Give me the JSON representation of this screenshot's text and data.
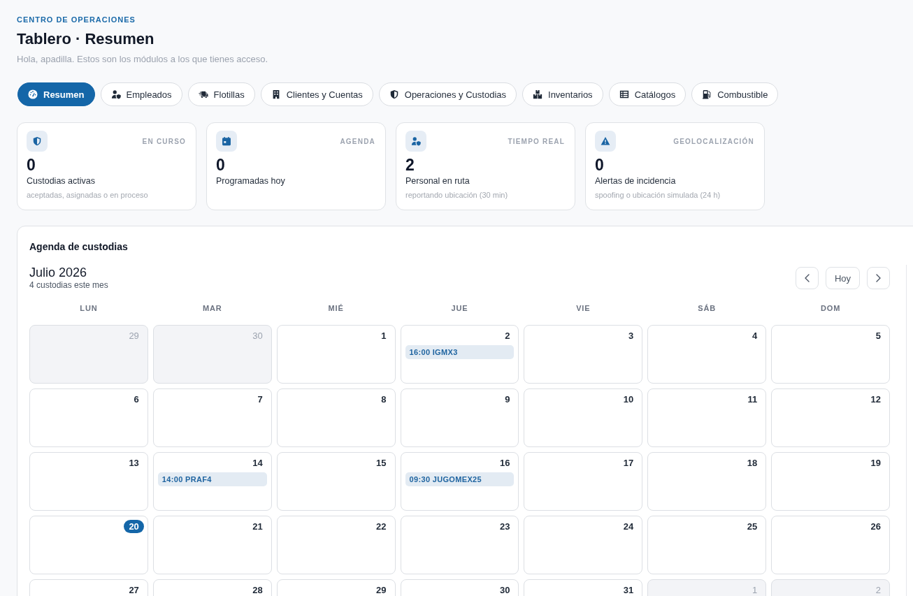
{
  "header": {
    "eyebrow": "CENTRO DE OPERACIONES",
    "title": "Tablero · Resumen",
    "subtitle": "Hola, apadilla. Estos son los módulos a los que tienes acceso."
  },
  "tabs": [
    {
      "label": "Resumen",
      "selected": true
    },
    {
      "label": "Empleados",
      "selected": false
    },
    {
      "label": "Flotillas",
      "selected": false
    },
    {
      "label": "Clientes y Cuentas",
      "selected": false
    },
    {
      "label": "Operaciones y Custodias",
      "selected": false
    },
    {
      "label": "Inventarios",
      "selected": false
    },
    {
      "label": "Catálogos",
      "selected": false
    },
    {
      "label": "Combustible",
      "selected": false
    }
  ],
  "stats": [
    {
      "tag": "EN CURSO",
      "value": "0",
      "label": "Custodias activas",
      "note": "aceptadas, asignadas o en proceso"
    },
    {
      "tag": "AGENDA",
      "value": "0",
      "label": "Programadas hoy"
    },
    {
      "tag": "TIEMPO REAL",
      "value": "2",
      "label": "Personal en ruta",
      "note": "reportando ubicación (30 min)"
    },
    {
      "tag": "GEOLOCALIZACIÓN",
      "value": "0",
      "label": "Alertas de incidencia",
      "note": "spoofing o ubicación simulada (24 h)"
    }
  ],
  "calendar": {
    "title": "Agenda de custodias",
    "month": "Julio 2026",
    "count": "4 custodias este mes",
    "today_button": "Hoy",
    "weekdays": [
      "LUN",
      "MAR",
      "MIÉ",
      "JUE",
      "VIE",
      "SÁB",
      "DOM"
    ],
    "weeks": [
      {
        "days": [
          {
            "day": "29",
            "outside": true,
            "today": false
          },
          {
            "day": "30",
            "outside": true,
            "today": false
          },
          {
            "day": "1",
            "outside": false,
            "today": false
          },
          {
            "day": "2",
            "outside": false,
            "today": false,
            "events": [
              {
                "label": "16:00 IGMX3"
              }
            ]
          },
          {
            "day": "3",
            "outside": false,
            "today": false
          },
          {
            "day": "4",
            "outside": false,
            "today": false
          },
          {
            "day": "5",
            "outside": false,
            "today": false
          }
        ]
      },
      {
        "days": [
          {
            "day": "6",
            "outside": false,
            "today": false
          },
          {
            "day": "7",
            "outside": false,
            "today": false
          },
          {
            "day": "8",
            "outside": false,
            "today": false
          },
          {
            "day": "9",
            "outside": false,
            "today": false
          },
          {
            "day": "10",
            "outside": false,
            "today": false
          },
          {
            "day": "11",
            "outside": false,
            "today": false
          },
          {
            "day": "12",
            "outside": false,
            "today": false
          }
        ]
      },
      {
        "days": [
          {
            "day": "13",
            "outside": false,
            "today": false
          },
          {
            "day": "14",
            "outside": false,
            "today": false,
            "events": [
              {
                "label": "14:00 PRAF4"
              }
            ]
          },
          {
            "day": "15",
            "outside": false,
            "today": false
          },
          {
            "day": "16",
            "outside": false,
            "today": false,
            "events": [
              {
                "label": "09:30 JUGOMEX25"
              }
            ]
          },
          {
            "day": "17",
            "outside": false,
            "today": false
          },
          {
            "day": "18",
            "outside": false,
            "today": false
          },
          {
            "day": "19",
            "outside": false,
            "today": false
          }
        ]
      },
      {
        "days": [
          {
            "day": "20",
            "outside": false,
            "today": true
          },
          {
            "day": "21",
            "outside": false,
            "today": false
          },
          {
            "day": "22",
            "outside": false,
            "today": false
          },
          {
            "day": "23",
            "outside": false,
            "today": false
          },
          {
            "day": "24",
            "outside": false,
            "today": false
          },
          {
            "day": "25",
            "outside": false,
            "today": false
          },
          {
            "day": "26",
            "outside": false,
            "today": false
          }
        ]
      },
      {
        "days": [
          {
            "day": "27",
            "outside": false,
            "today": false
          },
          {
            "day": "28",
            "outside": false,
            "today": false
          },
          {
            "day": "29",
            "outside": false,
            "today": false
          },
          {
            "day": "30",
            "outside": false,
            "today": false
          },
          {
            "day": "31",
            "outside": false,
            "today": false
          },
          {
            "day": "1",
            "outside": true,
            "today": false
          },
          {
            "day": "2",
            "outside": true,
            "today": false
          }
        ]
      }
    ]
  }
}
